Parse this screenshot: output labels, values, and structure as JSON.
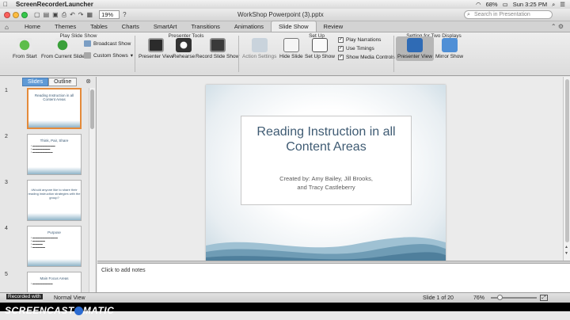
{
  "menubar": {
    "app_name": "ScreenRecorderLauncher",
    "battery": "68%",
    "clock": "Sun 3:25 PM"
  },
  "window": {
    "doc_title": "WorkShop Powerpoint (3).pptx",
    "zoom": "19%",
    "search_placeholder": "Search in Presentation"
  },
  "ribbon_tabs": [
    "Home",
    "Themes",
    "Tables",
    "Charts",
    "SmartArt",
    "Transitions",
    "Animations",
    "Slide Show",
    "Review"
  ],
  "ribbon": {
    "groups": {
      "play": "Play Slide Show",
      "presenter": "Presenter Tools",
      "setup": "Set Up",
      "two_displays": "Setting for Two Displays"
    },
    "buttons": {
      "from_start": "From Start",
      "from_current": "From Current Slide",
      "broadcast": "Broadcast Show",
      "custom_shows": "Custom Shows",
      "presenter_view": "Presenter View",
      "rehearse": "Rehearse",
      "record": "Record Slide Show",
      "action_settings": "Action Settings",
      "hide_slide": "Hide Slide",
      "set_up_show": "Set Up Show",
      "presenter_view2": "Presenter View",
      "mirror_show": "Mirror Show"
    },
    "checkboxes": {
      "narrations": "Play Narrations",
      "timings": "Use Timings",
      "media": "Show Media Controls"
    }
  },
  "left_pane": {
    "tab_slides": "Slides",
    "tab_outline": "Outline",
    "thumbs": [
      {
        "num": "1",
        "title": "Reading Instruction in all Content Areas",
        "body": ""
      },
      {
        "num": "2",
        "title": "Think, Pair, Share",
        "body": ""
      },
      {
        "num": "3",
        "title": "•Would anyone like to share their reading instruction strategies with the group?",
        "body": ""
      },
      {
        "num": "4",
        "title": "Purpose",
        "body": ""
      },
      {
        "num": "5",
        "title": "Main Focus Areas",
        "body": ""
      }
    ]
  },
  "slide": {
    "title": "Reading Instruction in all Content Areas",
    "subtitle_line1": "Created by: Amy Bailey, Jill Brooks,",
    "subtitle_line2": "and Tracy Castleberry"
  },
  "notes": {
    "placeholder": "Click to add notes"
  },
  "status": {
    "view": "Normal View",
    "slide_count": "Slide 1 of 20",
    "zoom": "76%"
  },
  "overlay": {
    "recorded_with": "Recorded with",
    "watermark_left": "SCREENCAST",
    "watermark_right": "MATIC"
  },
  "colors": {
    "accent_blue": "#5f9ad6",
    "selected_orange": "#e48a3a",
    "slide_title": "#3f5b73"
  }
}
